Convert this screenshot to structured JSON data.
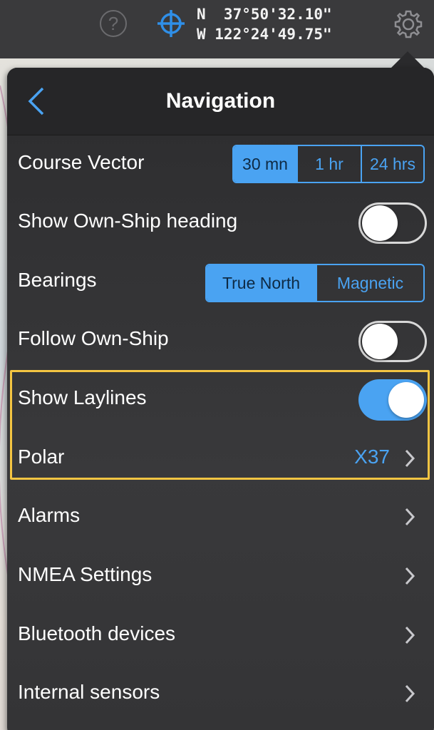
{
  "toolbar": {
    "help_glyph": "?",
    "coordinates": {
      "lat": "N  37°50'32.10\"",
      "lon": "W 122°24'49.75\""
    },
    "icons": [
      "help-icon",
      "crosshair-icon",
      "gear-icon"
    ]
  },
  "panel": {
    "title": "Navigation",
    "rows": [
      {
        "label": "Course Vector",
        "control": "segmented",
        "options": [
          "30 mn",
          "1 hr",
          "24 hrs"
        ],
        "selected": "30 mn"
      },
      {
        "label": "Show Own-Ship heading",
        "control": "toggle",
        "on": false
      },
      {
        "label": "Bearings",
        "control": "segmented",
        "options": [
          "True North",
          "Magnetic"
        ],
        "selected": "True North"
      },
      {
        "label": "Follow Own-Ship",
        "control": "toggle",
        "on": false
      },
      {
        "label": "Show Laylines",
        "control": "toggle",
        "on": true
      },
      {
        "label": "Polar",
        "control": "disclosure",
        "value": "X37"
      },
      {
        "label": "Alarms",
        "control": "disclosure"
      },
      {
        "label": "NMEA Settings",
        "control": "disclosure"
      },
      {
        "label": "Bluetooth devices",
        "control": "disclosure"
      },
      {
        "label": "Internal sensors",
        "control": "disclosure"
      }
    ]
  },
  "colors": {
    "accent": "#4aa3f2",
    "highlight": "#f4c542",
    "toolbar_bg": "#3a3a3c",
    "panel_bg": "#333335"
  }
}
